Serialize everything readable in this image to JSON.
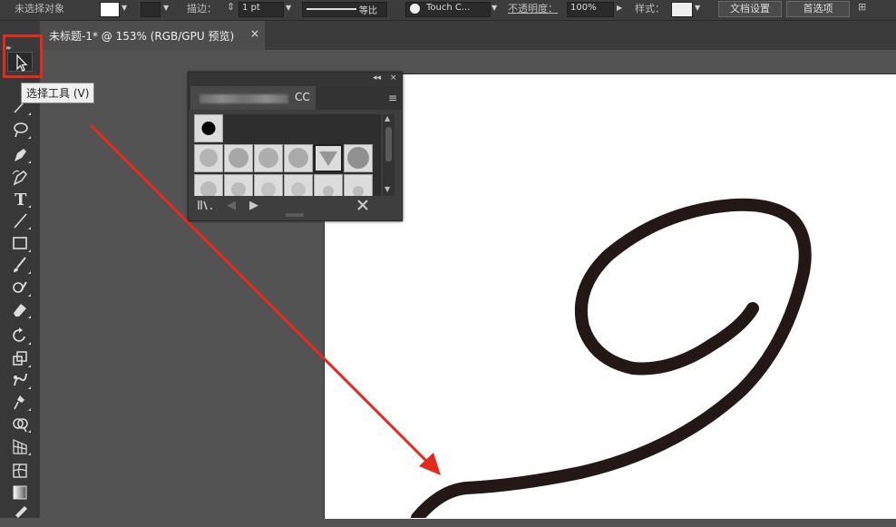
{
  "control_bar": {
    "left_label": "未选择对象",
    "stroke_label": "描边：",
    "stroke_weight": "1 pt",
    "line_label": "等比",
    "brush_label": "Touch C...",
    "opacity_label": "不透明度：",
    "opacity_value": "100%",
    "style_label": "样式：",
    "doc_setup_button": "文档设置",
    "prefs_button": "首选项"
  },
  "document_tab": {
    "title": "未标题-1* @ 153% (RGB/GPU 预览)",
    "close_glyph": "×"
  },
  "tooltip": {
    "text": "选择工具 (V)"
  },
  "brush_panel": {
    "tab_label_suffix": "CC",
    "menu_glyph": "≡",
    "collapse_glyph": "◂◂",
    "close_glyph": "×"
  },
  "colors": {
    "highlight": "#e32a1b",
    "arrow": "#e32a1b",
    "curve": "#231815"
  }
}
